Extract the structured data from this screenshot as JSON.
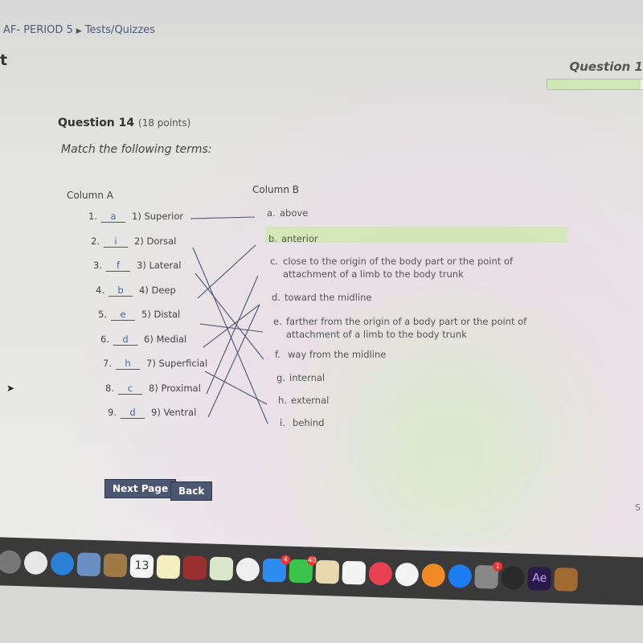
{
  "breadcrumb": {
    "course": "AF- PERIOD 5",
    "section": "Tests/Quizzes"
  },
  "page_title_fragment": "t",
  "progress": {
    "label": "Question 1",
    "fraction": 0.93,
    "color": "#cfe8b4"
  },
  "question": {
    "title": "Question 14",
    "points": "(18 points)",
    "instruction": "Match the following terms:"
  },
  "column_a": {
    "header": "Column A",
    "items": [
      {
        "num": "1.",
        "answer": "a",
        "term": "1) Superior"
      },
      {
        "num": "2.",
        "answer": "i",
        "term": "2) Dorsal"
      },
      {
        "num": "3.",
        "answer": "f",
        "term": "3) Lateral"
      },
      {
        "num": "4.",
        "answer": "b",
        "term": "4) Deep"
      },
      {
        "num": "5.",
        "answer": "e",
        "term": "5) Distal"
      },
      {
        "num": "6.",
        "answer": "d",
        "term": "6) Medial"
      },
      {
        "num": "7.",
        "answer": "h",
        "term": "7) Superficial"
      },
      {
        "num": "8.",
        "answer": "c",
        "term": "8) Proximal"
      },
      {
        "num": "9.",
        "answer": "d",
        "term": "9) Ventral"
      }
    ]
  },
  "column_b": {
    "header": "Column B",
    "items": [
      {
        "letter": "a.",
        "text": "above"
      },
      {
        "letter": "b.",
        "text": "anterior"
      },
      {
        "letter": "c.",
        "text": "close to the origin of the body part or the point of",
        "text2": "attachment of a limb to the body trunk"
      },
      {
        "letter": "d.",
        "text": "toward the midline"
      },
      {
        "letter": "e.",
        "text": "farther from the origin of a body part or the point of",
        "text2": "attachment of a limb to the body trunk"
      },
      {
        "letter": "f.",
        "text": "way from the midline"
      },
      {
        "letter": "g.",
        "text": "internal"
      },
      {
        "letter": "h.",
        "text": "external"
      },
      {
        "letter": "i.",
        "text": "behind"
      }
    ]
  },
  "buttons": {
    "next": "Next Page",
    "back": "Back"
  },
  "edge_text": "S",
  "dock": {
    "items": [
      {
        "name": "launchpad"
      },
      {
        "name": "chrome"
      },
      {
        "name": "safari"
      },
      {
        "name": "mail"
      },
      {
        "name": "notefile"
      },
      {
        "name": "calendar",
        "label": "13"
      },
      {
        "name": "notes"
      },
      {
        "name": "photo-booth"
      },
      {
        "name": "maps"
      },
      {
        "name": "photos"
      },
      {
        "name": "messages",
        "badge": "4"
      },
      {
        "name": "facetime",
        "badge": "40"
      },
      {
        "name": "preview"
      },
      {
        "name": "numbers"
      },
      {
        "name": "news"
      },
      {
        "name": "music"
      },
      {
        "name": "books"
      },
      {
        "name": "app-store"
      },
      {
        "name": "system-preferences",
        "badge": "1"
      },
      {
        "name": "obs"
      },
      {
        "name": "after-effects",
        "label": "Ae"
      },
      {
        "name": "garageband"
      }
    ]
  }
}
